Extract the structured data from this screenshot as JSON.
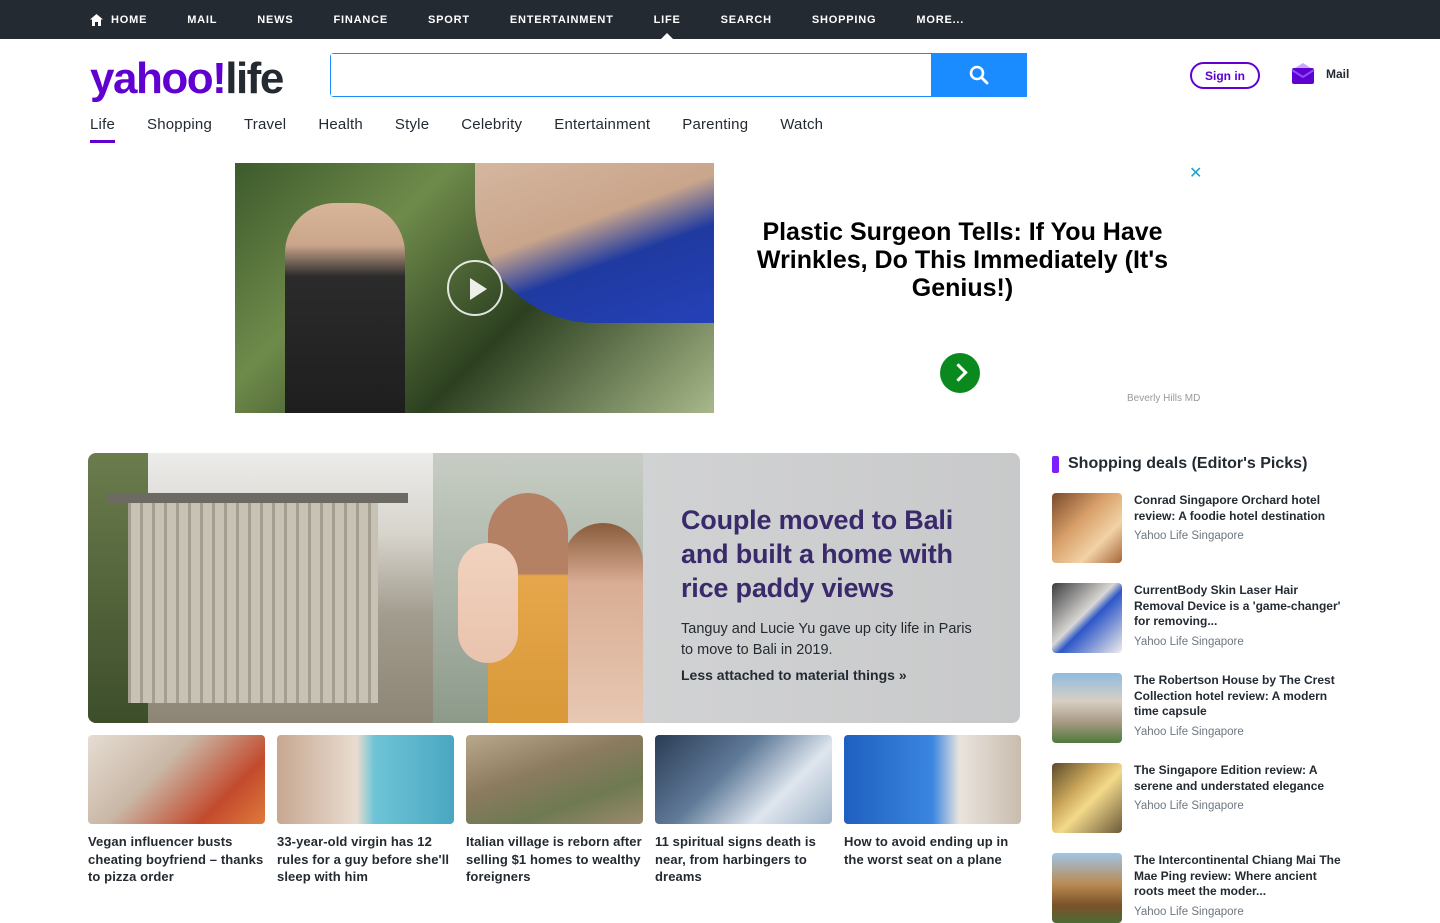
{
  "top_nav": [
    {
      "label": "HOME"
    },
    {
      "label": "MAIL"
    },
    {
      "label": "NEWS"
    },
    {
      "label": "FINANCE"
    },
    {
      "label": "SPORT"
    },
    {
      "label": "ENTERTAINMENT"
    },
    {
      "label": "LIFE"
    },
    {
      "label": "SEARCH"
    },
    {
      "label": "SHOPPING"
    },
    {
      "label": "MORE..."
    }
  ],
  "header": {
    "logo_brand": "yahoo!",
    "logo_section": "life",
    "search_placeholder": "",
    "signin_label": "Sign in",
    "mail_label": "Mail"
  },
  "sub_nav": [
    "Life",
    "Shopping",
    "Travel",
    "Health",
    "Style",
    "Celebrity",
    "Entertainment",
    "Parenting",
    "Watch"
  ],
  "ad": {
    "headline": "Plastic Surgeon Tells: If You Have Wrinkles, Do This Immediately (It's Genius!)",
    "sponsor": "Beverly Hills MD",
    "close_glyph": "✕"
  },
  "hero": {
    "title": "Couple moved to Bali and built a home with rice paddy views",
    "summary": "Tanguy and Lucie Yu gave up city life in Paris to move to Bali in 2019.",
    "link": "Less attached to material things »"
  },
  "stories": [
    {
      "title": "Vegan influencer busts cheating boyfriend – thanks to pizza order"
    },
    {
      "title": "33-year-old virgin has 12 rules for a guy before she'll sleep with him"
    },
    {
      "title": "Italian village is reborn after selling $1 homes to wealthy foreigners"
    },
    {
      "title": "11 spiritual signs death is near, from harbingers to dreams"
    },
    {
      "title": "How to avoid ending up in the worst seat on a plane"
    }
  ],
  "sidebar": {
    "heading": "Shopping deals (Editor's Picks)",
    "items": [
      {
        "title": "Conrad Singapore Orchard hotel review: A foodie hotel destination",
        "source": "Yahoo Life Singapore"
      },
      {
        "title": "CurrentBody Skin Laser Hair Removal Device is a 'game-changer' for removing...",
        "source": "Yahoo Life Singapore"
      },
      {
        "title": "The Robertson House by The Crest Collection hotel review: A modern time capsule",
        "source": "Yahoo Life Singapore"
      },
      {
        "title": "The Singapore Edition review: A serene and understated elegance",
        "source": "Yahoo Life Singapore"
      },
      {
        "title": "The Intercontinental Chiang Mai The Mae Ping review: Where ancient roots meet the moder...",
        "source": "Yahoo Life Singapore"
      }
    ]
  },
  "colors": {
    "brand_purple": "#6001d2",
    "search_blue": "#1a8cff",
    "topbar_bg": "#232a31",
    "ad_cta_green": "#0a8a1e"
  }
}
